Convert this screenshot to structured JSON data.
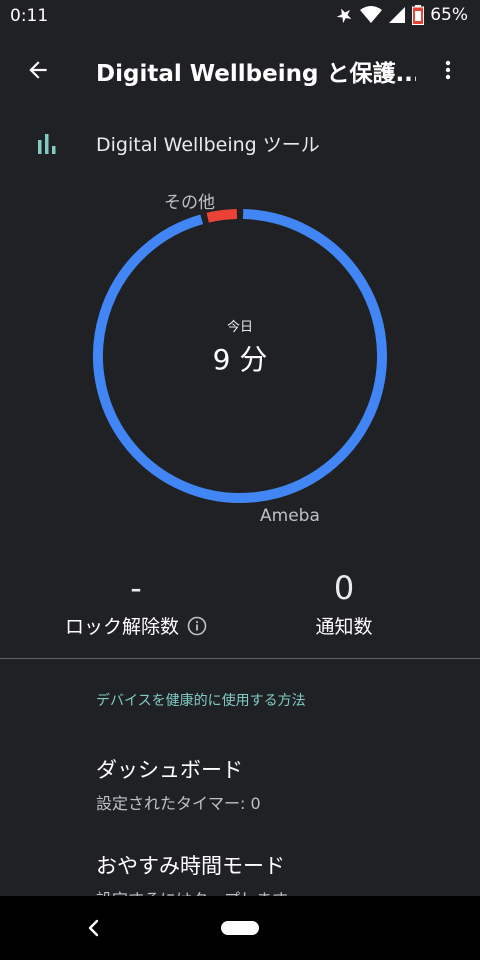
{
  "status_bar": {
    "time": "0:11",
    "battery_percent": "65%",
    "icons": [
      "dnd-icon",
      "wifi-icon",
      "signal-icon",
      "battery-icon"
    ]
  },
  "app_bar": {
    "title": "Digital Wellbeing と保護...",
    "back_icon": "arrow-back-icon",
    "overflow_icon": "more-vert-icon"
  },
  "tools": {
    "label": "Digital Wellbeing ツール",
    "icon": "bar-chart-icon"
  },
  "usage_chart": {
    "today_label": "今日",
    "today_value": "9 分",
    "other_label": "その他",
    "app_label": "Ameba"
  },
  "chart_data": {
    "type": "pie",
    "style": "donut",
    "slices": [
      {
        "label": "Ameba",
        "value": 0.96,
        "color": "#4285f4"
      },
      {
        "label": "その他",
        "value": 0.04,
        "color": "#ea4335"
      }
    ]
  },
  "stats": {
    "unlocks_value": "-",
    "unlocks_label": "ロック解除数",
    "notifications_value": "0",
    "notifications_label": "通知数"
  },
  "section": {
    "header": "デバイスを健康的に使用する方法"
  },
  "items": [
    {
      "title": "ダッシュボード",
      "subtitle": "設定されたタイマー: 0"
    },
    {
      "title": "おやすみ時間モード",
      "subtitle": "設定するにはタップします"
    }
  ],
  "colors": {
    "background": "#202124",
    "accent_teal": "#80cbc4",
    "ring_blue": "#4285f4",
    "ring_red": "#ea4335"
  }
}
